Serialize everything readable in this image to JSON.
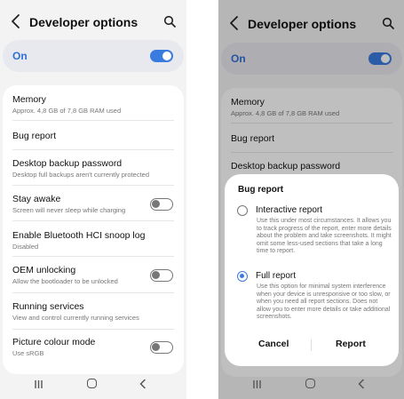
{
  "left_screen": {
    "title": "Developer options",
    "master_toggle": {
      "label": "On",
      "state": "on"
    },
    "items": [
      {
        "title": "Memory",
        "subtitle": "Approx. 4,8 GB of 7,8 GB RAM used"
      },
      {
        "title": "Bug report"
      },
      {
        "title": "Desktop backup password",
        "subtitle": "Desktop full backups aren't currently protected"
      },
      {
        "title": "Stay awake",
        "subtitle": "Screen will never sleep while charging",
        "toggle": "off"
      },
      {
        "title": "Enable Bluetooth HCI snoop log",
        "subtitle": "Disabled"
      },
      {
        "title": "OEM unlocking",
        "subtitle": "Allow the bootloader to be unlocked",
        "toggle": "off"
      },
      {
        "title": "Running services",
        "subtitle": "View and control currently running services"
      },
      {
        "title": "Picture colour mode",
        "subtitle": "Use sRGB",
        "toggle": "off"
      }
    ]
  },
  "right_screen": {
    "title": "Developer options",
    "master_toggle": {
      "label": "On",
      "state": "on"
    },
    "items": [
      {
        "title": "Memory",
        "subtitle": "Approx. 4,8 GB of 7,8 GB RAM used"
      },
      {
        "title": "Bug report"
      },
      {
        "title": "Desktop backup password"
      }
    ],
    "dialog": {
      "title": "Bug report",
      "options": [
        {
          "title": "Interactive report",
          "selected": false,
          "description": "Use this under most circumstances. It allows you to track progress of the report, enter more details about the problem and take screenshots. It might omit some less-used sections that take a long time to report."
        },
        {
          "title": "Full report",
          "selected": true,
          "description": "Use this option for minimal system interference when your device is unresponsive or too slow, or when you need all report sections. Does not allow you to enter more details or take additional screenshots."
        }
      ],
      "cancel_label": "Cancel",
      "confirm_label": "Report"
    }
  },
  "colors": {
    "accent": "#3a7be0",
    "on_label": "#2e6fd8",
    "background": "#f3f3f3",
    "card": "#ffffff",
    "subtitle": "#777777"
  },
  "icons": {
    "back": "back-arrow-icon",
    "search": "search-icon",
    "nav_recent": "recent-apps-icon",
    "nav_home": "home-icon",
    "nav_back": "nav-back-icon"
  }
}
